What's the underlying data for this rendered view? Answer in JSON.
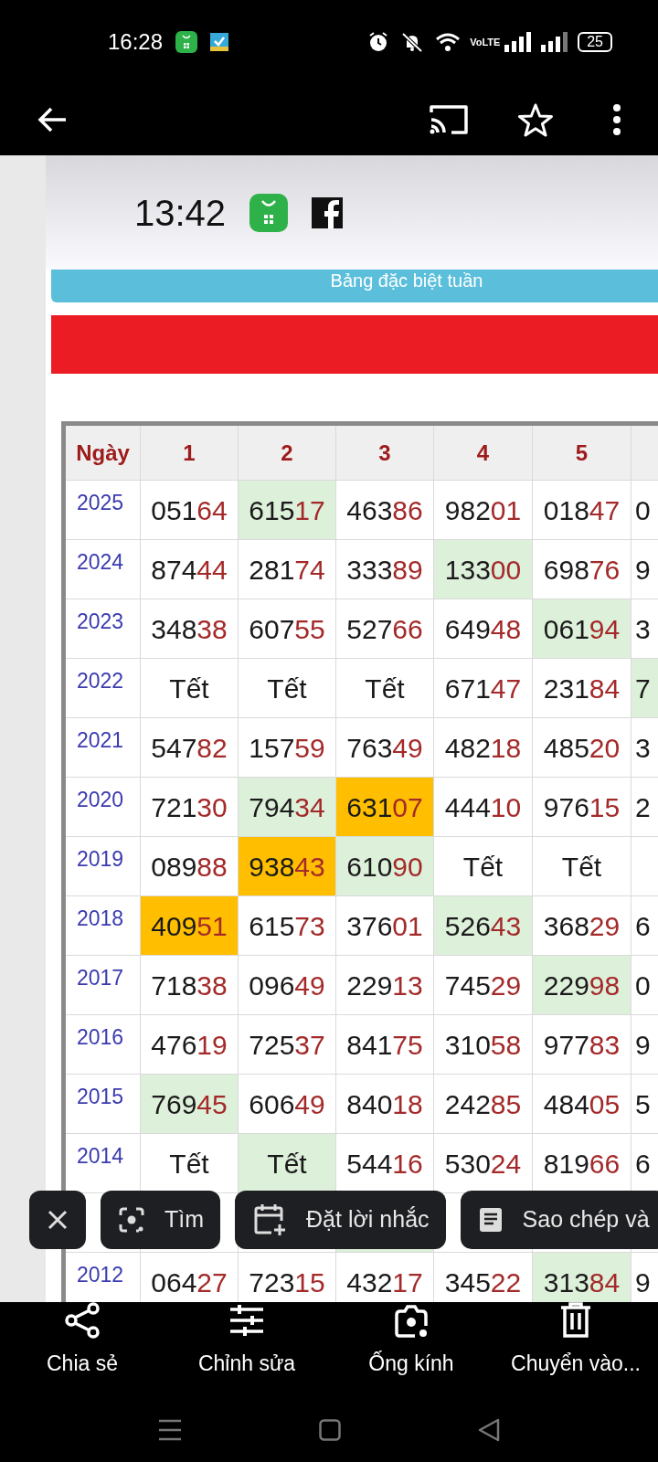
{
  "status_bar": {
    "time": "16:28",
    "network_label": "VoLTE",
    "battery": "25"
  },
  "photo": {
    "time": "13:42",
    "banner": "Bảng đặc biệt tuần",
    "table": {
      "columns": [
        "Ngày",
        "1",
        "2",
        "3",
        "4",
        "5"
      ],
      "rows": [
        {
          "cells": [
            {
              "text": "2025"
            },
            {
              "text": "051",
              "tail": "64"
            },
            {
              "text": "615",
              "tail": "17",
              "color": "#ddf0da"
            },
            {
              "text": "463",
              "tail": "86"
            },
            {
              "text": "982",
              "tail": "01"
            },
            {
              "text": "018",
              "tail": "47"
            },
            {
              "text": "0"
            }
          ]
        },
        {
          "cells": [
            {
              "text": "2024"
            },
            {
              "text": "874",
              "tail": "44"
            },
            {
              "text": "281",
              "tail": "74"
            },
            {
              "text": "333",
              "tail": "89"
            },
            {
              "text": "133",
              "tail": "00",
              "color": "#ddf0da"
            },
            {
              "text": "698",
              "tail": "76"
            },
            {
              "text": "9"
            }
          ]
        },
        {
          "cells": [
            {
              "text": "2023"
            },
            {
              "text": "348",
              "tail": "38"
            },
            {
              "text": "607",
              "tail": "55"
            },
            {
              "text": "527",
              "tail": "66"
            },
            {
              "text": "649",
              "tail": "48"
            },
            {
              "text": "061",
              "tail": "94",
              "color": "#ddf0da"
            },
            {
              "text": "3"
            }
          ]
        },
        {
          "cells": [
            {
              "text": "2022"
            },
            {
              "text": "Tết"
            },
            {
              "text": "Tết"
            },
            {
              "text": "Tết"
            },
            {
              "text": "671",
              "tail": "47"
            },
            {
              "text": "231",
              "tail": "84"
            },
            {
              "text": "7",
              "color": "#ddf0da"
            }
          ]
        },
        {
          "cells": [
            {
              "text": "2021"
            },
            {
              "text": "547",
              "tail": "82"
            },
            {
              "text": "157",
              "tail": "59"
            },
            {
              "text": "763",
              "tail": "49"
            },
            {
              "text": "482",
              "tail": "18"
            },
            {
              "text": "485",
              "tail": "20"
            },
            {
              "text": "3"
            }
          ]
        },
        {
          "cells": [
            {
              "text": "2020"
            },
            {
              "text": "721",
              "tail": "30"
            },
            {
              "text": "794",
              "tail": "34",
              "color": "#ddf0da"
            },
            {
              "text": "631",
              "tail": "07",
              "color": "#ffbf00"
            },
            {
              "text": "444",
              "tail": "10"
            },
            {
              "text": "976",
              "tail": "15"
            },
            {
              "text": "2"
            }
          ]
        },
        {
          "cells": [
            {
              "text": "2019"
            },
            {
              "text": "089",
              "tail": "88"
            },
            {
              "text": "938",
              "tail": "43",
              "color": "#ffbf00"
            },
            {
              "text": "610",
              "tail": "90",
              "color": "#ddf0da"
            },
            {
              "text": "Tết"
            },
            {
              "text": "Tết"
            },
            {}
          ]
        },
        {
          "cells": [
            {
              "text": "2018"
            },
            {
              "text": "409",
              "tail": "51",
              "color": "#ffbf00"
            },
            {
              "text": "615",
              "tail": "73"
            },
            {
              "text": "376",
              "tail": "01"
            },
            {
              "text": "526",
              "tail": "43",
              "color": "#ddf0da"
            },
            {
              "text": "368",
              "tail": "29"
            },
            {
              "text": "6"
            }
          ]
        },
        {
          "cells": [
            {
              "text": "2017"
            },
            {
              "text": "718",
              "tail": "38"
            },
            {
              "text": "096",
              "tail": "49"
            },
            {
              "text": "229",
              "tail": "13"
            },
            {
              "text": "745",
              "tail": "29"
            },
            {
              "text": "229",
              "tail": "98",
              "color": "#ddf0da"
            },
            {
              "text": "0"
            }
          ]
        },
        {
          "cells": [
            {
              "text": "2016"
            },
            {
              "text": "476",
              "tail": "19"
            },
            {
              "text": "725",
              "tail": "37"
            },
            {
              "text": "841",
              "tail": "75"
            },
            {
              "text": "310",
              "tail": "58"
            },
            {
              "text": "977",
              "tail": "83"
            },
            {
              "text": "9"
            }
          ]
        },
        {
          "cells": [
            {
              "text": "2015"
            },
            {
              "text": "769",
              "tail": "45",
              "color": "#ddf0da"
            },
            {
              "text": "606",
              "tail": "49"
            },
            {
              "text": "840",
              "tail": "18"
            },
            {
              "text": "242",
              "tail": "85"
            },
            {
              "text": "484",
              "tail": "05"
            },
            {
              "text": "5"
            }
          ]
        },
        {
          "cells": [
            {
              "text": "2014"
            },
            {
              "text": "Tết"
            },
            {
              "text": "Tết",
              "color": "#ddf0da"
            },
            {
              "text": "544",
              "tail": "16"
            },
            {
              "text": "530",
              "tail": "24"
            },
            {
              "text": "819",
              "tail": "66"
            },
            {
              "text": "6"
            }
          ]
        },
        {
          "cells": [
            {},
            {},
            {},
            {
              "color": "#ddf0da"
            },
            {},
            {},
            {}
          ]
        },
        {
          "cells": [
            {
              "text": "2012"
            },
            {
              "text": "064",
              "tail": "27"
            },
            {
              "text": "723",
              "tail": "15"
            },
            {
              "text": "432",
              "tail": "17"
            },
            {
              "text": "345",
              "tail": "22"
            },
            {
              "text": "313",
              "tail": "84",
              "color": "#ddf0da"
            },
            {
              "text": "9"
            }
          ]
        }
      ]
    }
  },
  "chips": [
    {
      "kind": "close"
    },
    {
      "kind": "lens",
      "label": "Tìm"
    },
    {
      "kind": "reminder",
      "label": "Đặt lời nhắc"
    },
    {
      "kind": "copy",
      "label": "Sao chép và"
    }
  ],
  "actions": [
    {
      "kind": "share",
      "label": "Chia sẻ"
    },
    {
      "kind": "edit",
      "label": "Chỉnh sửa"
    },
    {
      "kind": "lens",
      "label": "Ống kính"
    },
    {
      "kind": "trash",
      "label": "Chuyển vào..."
    }
  ]
}
